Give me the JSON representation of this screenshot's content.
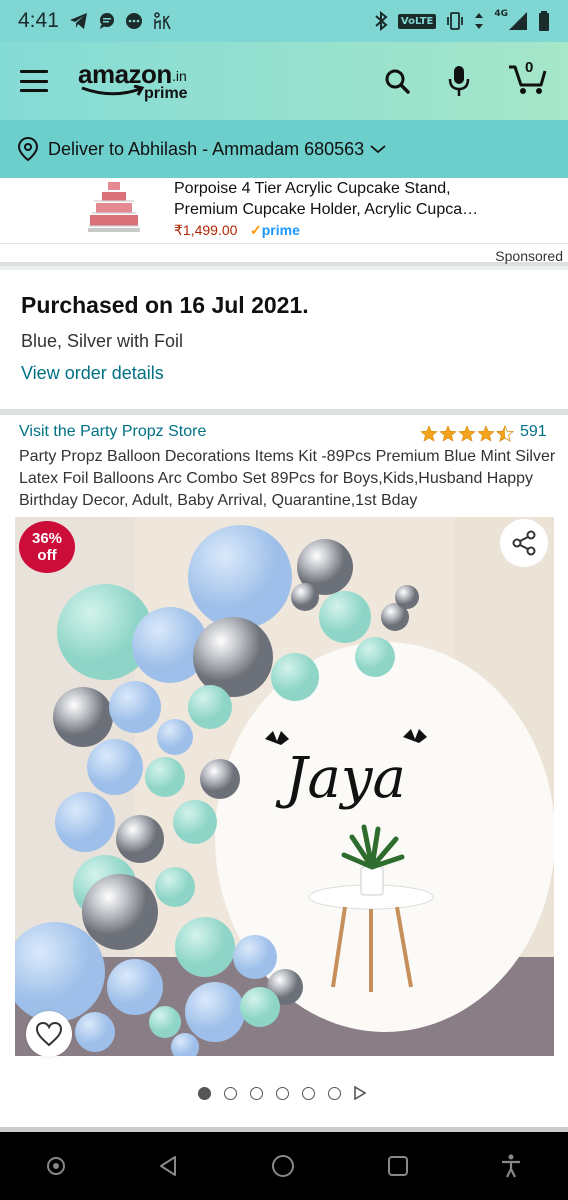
{
  "status_bar": {
    "time": "4:41",
    "volte": "VoLTE",
    "network": "4G"
  },
  "header": {
    "logo_word": "amazon",
    "logo_suffix": ".in",
    "logo_prime": "prime",
    "cart_count": "0"
  },
  "delivery": {
    "text": "Deliver to Abhilash - Ammadam 680563"
  },
  "sponsored_ad": {
    "title_line1": "Porpoise 4 Tier Acrylic Cupcake Stand,",
    "title_line2": "Premium Cupcake Holder, Acrylic Cupca…",
    "price": "₹1,499.00",
    "prime_label": "prime",
    "sponsored_label": "Sponsored"
  },
  "purchase": {
    "heading": "Purchased on 16 Jul 2021.",
    "variant": "Blue, Silver with Foil",
    "link": "View order details"
  },
  "product": {
    "store_link": "Visit the Party Propz Store",
    "rating": 4.5,
    "rating_count": "591",
    "title": "Party Propz Balloon Decorations Items Kit -89Pcs Premium Blue Mint Silver Latex Foil Balloons Arc Combo Set 89Pcs for Boys,Kids,Husband Happy Birthday Decor, Adult, Baby Arrival, Quarantine,1st Bday",
    "discount_line1": "36%",
    "discount_line2": "off",
    "image_text": "Jaya",
    "image_count": 6,
    "active_image": 1
  },
  "colors": {
    "header_teal": "#84dbd5",
    "delivery_teal": "#6dcfcb",
    "link": "#007185",
    "price": "#b12704",
    "badge": "#cc0c39",
    "star": "#f4a41c"
  }
}
